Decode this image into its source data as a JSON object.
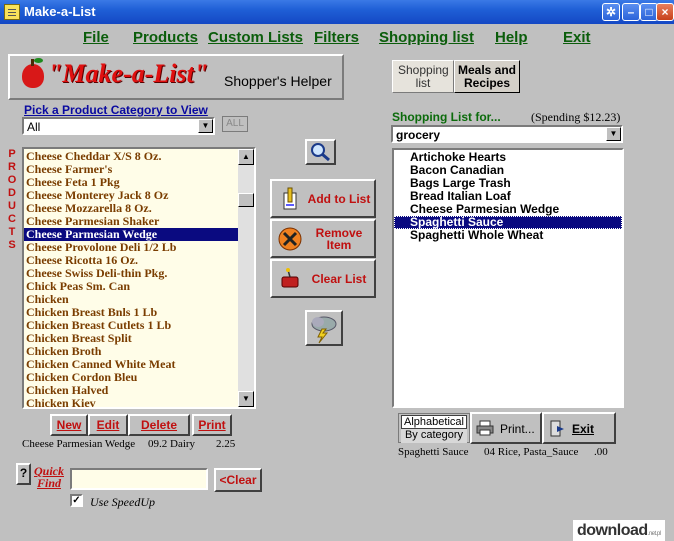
{
  "window": {
    "title": "Make-a-List"
  },
  "menu": [
    "File",
    "Products",
    "Custom Lists",
    "Filters",
    "Shopping list",
    "Help",
    "Exit"
  ],
  "logo": {
    "title": "\"Make-a-List\"",
    "tagline": "Shopper's Helper"
  },
  "tabs": {
    "active": "Shopping list",
    "inactive": "Meals and Recipes"
  },
  "category": {
    "label": "Pick a Product Category to View",
    "value": "All",
    "all_button": "ALL"
  },
  "products_side_label": [
    "P",
    "R",
    "O",
    "D",
    "U",
    "C",
    "T",
    "S"
  ],
  "products": [
    "Cheese Cheddar X/S 8 Oz.",
    "Cheese Farmer's",
    "Cheese Feta  1 Pkg",
    "Cheese Monterey Jack 8 Oz",
    "Cheese Mozzarella 8 Oz.",
    "Cheese Parmesian Shaker",
    "Cheese Parmesian Wedge",
    "Cheese Provolone Deli 1/2 Lb",
    "Cheese Ricotta 16 Oz.",
    "Cheese Swiss Deli-thin Pkg.",
    "Chick Peas Sm. Can",
    "Chicken",
    "Chicken Breast Bnls 1 Lb",
    "Chicken Breast Cutlets 1 Lb",
    "Chicken Breast Split",
    "Chicken Broth",
    "Chicken Canned White Meat",
    "Chicken Cordon Bleu",
    "Chicken Halved",
    "Chicken Kiev"
  ],
  "selected_product_index": 6,
  "product_buttons": {
    "new": "New",
    "edit": "Edit",
    "delete": "Delete",
    "print": "Print"
  },
  "product_info": {
    "name": "Cheese Parmesian Wedge",
    "code": "09.2 Dairy",
    "price": "2.25"
  },
  "actions": {
    "add": "Add to List",
    "remove_line1": "Remove",
    "remove_line2": "Item",
    "clear": "Clear List"
  },
  "shopping": {
    "label": "Shopping List for...",
    "spending": "(Spending $12.23)",
    "store": "grocery",
    "items": [
      "Artichoke Hearts",
      "Bacon Canadian",
      "Bags Large Trash",
      "Bread Italian Loaf",
      "Cheese Parmesian Wedge",
      "Spaghetti Sauce",
      "Spaghetti Whole Wheat"
    ],
    "selected_index": 5
  },
  "sort": {
    "alphabetical": "Alphabetical",
    "by_category": "By category"
  },
  "list_buttons": {
    "print": "Print...",
    "exit": "Exit"
  },
  "item_info": {
    "name": "Spaghetti Sauce",
    "code": "04 Rice, Pasta_Sauce",
    "price": ".00"
  },
  "quick_find": {
    "label_line1": "Quick",
    "label_line2": "Find",
    "value": "",
    "clear": "<Clear",
    "help": "?"
  },
  "speedup": {
    "label": "Use SpeedUp",
    "checked": true
  },
  "watermark": {
    "text": "download",
    "sub": ".net.pl"
  },
  "colors": {
    "title_bar": "#1f5fd6",
    "menu_text": "#0b5d0b",
    "accent_red": "#c01010",
    "selection": "#0a0a80",
    "product_text": "#7a3d00"
  }
}
